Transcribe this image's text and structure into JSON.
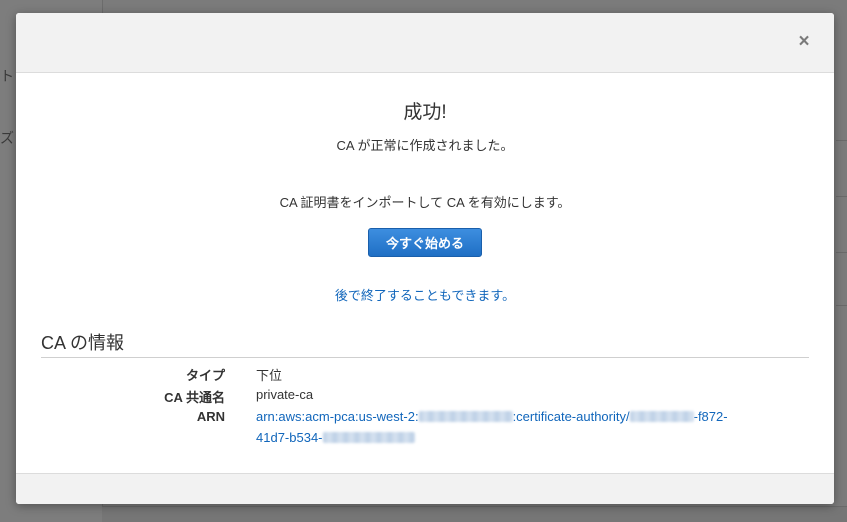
{
  "background": {
    "snippets": [
      "ト",
      "ズ"
    ]
  },
  "modal": {
    "close_glyph": "×",
    "success_title": "成功!",
    "success_message": "CA が正常に作成されました。",
    "import_message": "CA 証明書をインポートして CA を有効にします。",
    "start_button": "今すぐ始める",
    "later_link": "後で終了することもできます。",
    "section_title": "CA の情報",
    "info": {
      "type_label": "タイプ",
      "type_value": "下位",
      "common_name_label": "CA 共通名",
      "common_name_value": "private-ca",
      "arn_label": "ARN",
      "arn_part1": "arn:aws:acm-pca:us-west-2:",
      "arn_part2": ":certificate-authority/",
      "arn_part3": "-f872-",
      "arn_part4": "41d7-b534-"
    }
  },
  "colors": {
    "link": "#1166bb",
    "primary_button": "#1f6fc4",
    "header_bg": "#f2f2f2"
  }
}
